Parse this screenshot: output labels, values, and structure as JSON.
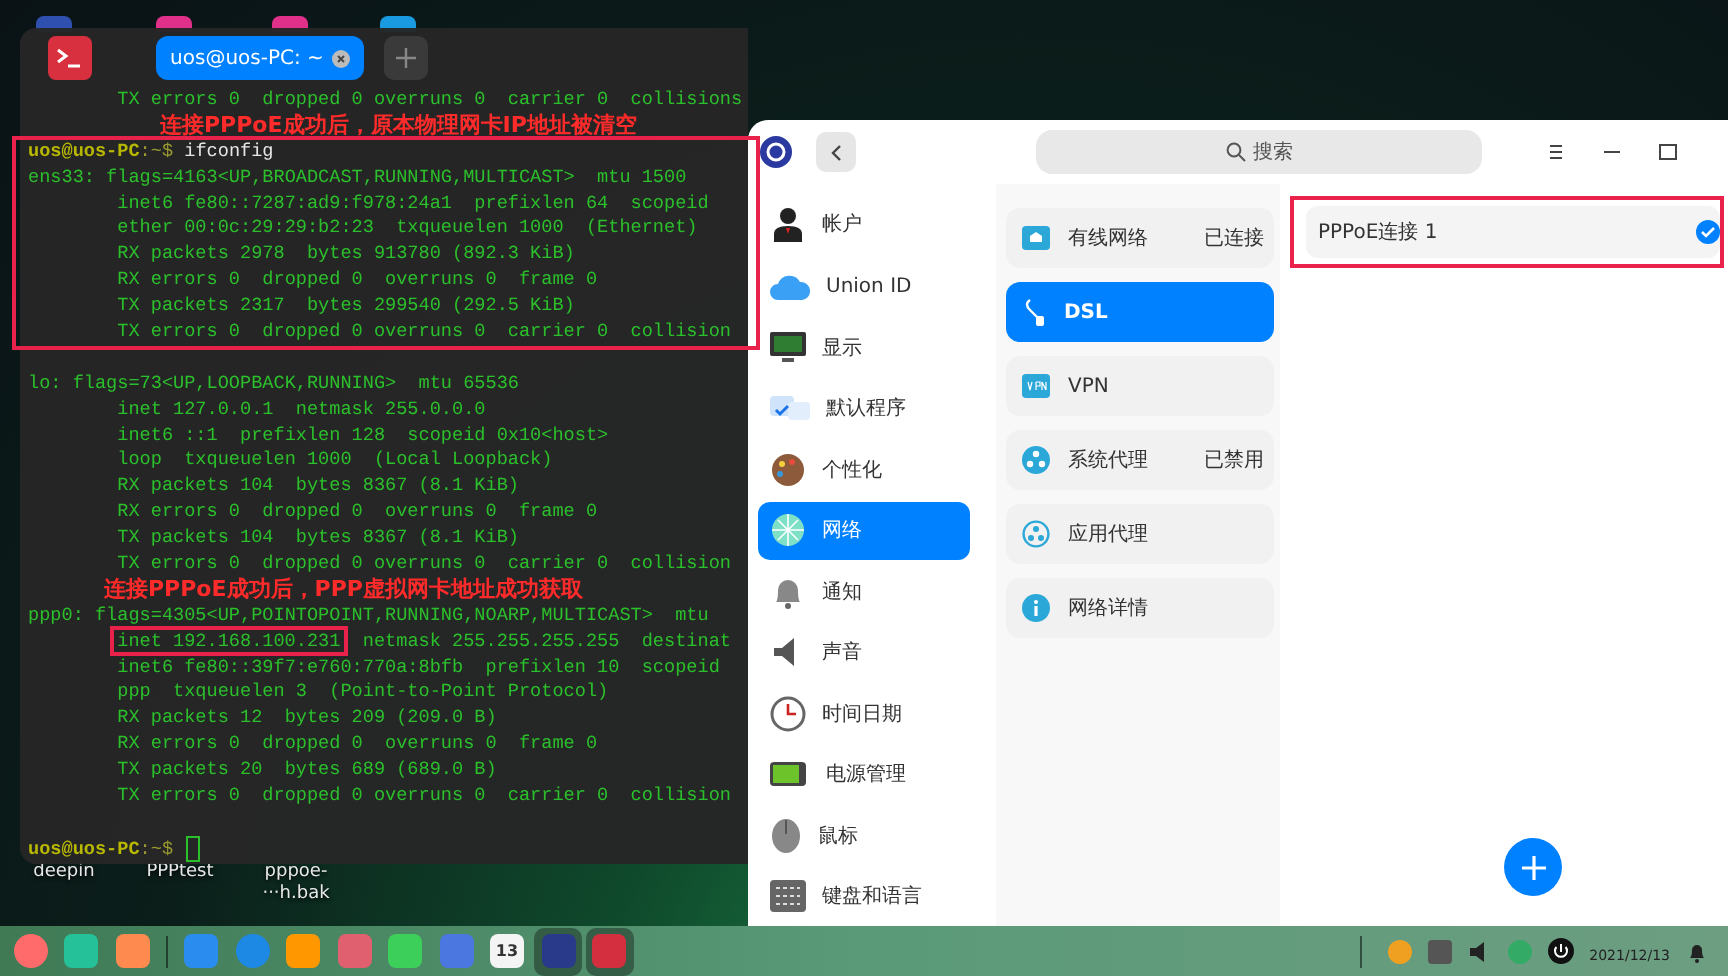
{
  "desktop": {
    "icons": [
      {
        "label_lines": [
          "deepin"
        ]
      },
      {
        "label_lines": [
          "PPPtest"
        ]
      },
      {
        "label_lines": [
          "pppoe-",
          "···h.bak"
        ]
      }
    ]
  },
  "terminal": {
    "tabs": [
      {
        "title": "uos@uos-PC: ~",
        "selected": true
      }
    ],
    "blocks": [
      {
        "highlighted": false,
        "lines": [
          {
            "kind": "output",
            "text": "        TX errors 0  dropped 0 overruns 0  carrier 0  collisions"
          },
          {
            "kind": "caption",
            "text": "连接PPPoE成功后，原本物理网卡IP地址被清空"
          }
        ]
      },
      {
        "highlighted": true,
        "lines": [
          {
            "kind": "prompt",
            "prompt": "uos@uos-PC",
            "path": ":~$",
            "command": "ifconfig",
            "cursor": false
          },
          {
            "kind": "output",
            "text": "ens33: flags=4163<UP,BROADCAST,RUNNING,MULTICAST>  mtu 1500"
          },
          {
            "kind": "output",
            "text": "        inet6 fe80::7287:ad9:f978:24a1  prefixlen 64  scopeid"
          },
          {
            "kind": "output",
            "text": "        ether 00:0c:29:29:b2:23  txqueuelen 1000  (Ethernet)"
          },
          {
            "kind": "output",
            "text": "        RX packets 2978  bytes 913780 (892.3 KiB)"
          },
          {
            "kind": "output",
            "text": "        RX errors 0  dropped 0  overruns 0  frame 0"
          },
          {
            "kind": "output",
            "text": "        TX packets 2317  bytes 299540 (292.5 KiB)"
          },
          {
            "kind": "output",
            "text": "        TX errors 0  dropped 0 overruns 0  carrier 0  collision"
          }
        ]
      },
      {
        "highlighted": false,
        "lines": [
          {
            "kind": "blank"
          },
          {
            "kind": "output",
            "text": "lo: flags=73<UP,LOOPBACK,RUNNING>  mtu 65536"
          },
          {
            "kind": "output",
            "text": "        inet 127.0.0.1  netmask 255.0.0.0"
          },
          {
            "kind": "output",
            "text": "        inet6 ::1  prefixlen 128  scopeid 0x10<host>"
          },
          {
            "kind": "output",
            "text": "        loop  txqueuelen 1000  (Local Loopback)"
          },
          {
            "kind": "output",
            "text": "        RX packets 104  bytes 8367 (8.1 KiB)"
          },
          {
            "kind": "output",
            "text": "        RX errors 0  dropped 0  overruns 0  frame 0"
          },
          {
            "kind": "output",
            "text": "        TX packets 104  bytes 8367 (8.1 KiB)"
          },
          {
            "kind": "output",
            "text": "        TX errors 0  dropped 0 overruns 0  carrier 0  collision"
          },
          {
            "kind": "caption",
            "text": "连接PPPoE成功后，PPP虚拟网卡地址成功获取"
          },
          {
            "kind": "output",
            "text": "ppp0: flags=4305<UP,POINTOPOINT,RUNNING,NOARP,MULTICAST>  mtu"
          },
          {
            "kind": "parts",
            "parts": [
              {
                "text": "inet 192.168.100.231",
                "highlighted": true
              },
              {
                "text": "  netmask 255.255.255.255  destinat",
                "highlighted": false
              }
            ]
          },
          {
            "kind": "output",
            "text": "        inet6 fe80::39f7:e760:770a:8bfb  prefixlen 10  scopeid"
          },
          {
            "kind": "output",
            "text": "        ppp  txqueuelen 3  (Point-to-Point Protocol)"
          },
          {
            "kind": "output",
            "text": "        RX packets 12  bytes 209 (209.0 B)"
          },
          {
            "kind": "output",
            "text": "        RX errors 0  dropped 0  overruns 0  frame 0"
          },
          {
            "kind": "output",
            "text": "        TX packets 20  bytes 689 (689.0 B)"
          },
          {
            "kind": "output",
            "text": "        TX errors 0  dropped 0 overruns 0  carrier 0  collision"
          },
          {
            "kind": "blank"
          },
          {
            "kind": "prompt",
            "prompt": "uos@uos-PC",
            "path": ":~$",
            "cursor": true
          }
        ]
      }
    ]
  },
  "control_center": {
    "search": {
      "placeholder": "搜索"
    },
    "sidebar": {
      "items": [
        {
          "label": "帐户",
          "selected": false
        },
        {
          "label": "Union ID",
          "selected": false
        },
        {
          "label": "显示",
          "selected": false
        },
        {
          "label": "默认程序",
          "selected": false
        },
        {
          "label": "个性化",
          "selected": false
        },
        {
          "label": "网络",
          "selected": true
        },
        {
          "label": "通知",
          "selected": false
        },
        {
          "label": "声音",
          "selected": false
        },
        {
          "label": "时间日期",
          "selected": false
        },
        {
          "label": "电源管理",
          "selected": false
        },
        {
          "label": "鼠标",
          "selected": false
        },
        {
          "label": "键盘和语言",
          "selected": false
        }
      ]
    },
    "network_items": [
      {
        "label": "有线网络",
        "status": "已连接",
        "selected": false
      },
      {
        "label": "DSL",
        "selected": true
      },
      {
        "label": "VPN",
        "selected": false
      },
      {
        "label": "系统代理",
        "status": "已禁用",
        "selected": false
      },
      {
        "label": "应用代理",
        "selected": false
      },
      {
        "label": "网络详情",
        "selected": false
      }
    ],
    "connections": [
      {
        "name": "PPPoE连接 1",
        "connected": true,
        "highlighted": true
      }
    ]
  },
  "taskbar": {
    "apps": [
      {
        "active": false
      },
      {
        "active": false
      },
      {
        "active": false
      },
      {
        "active": false
      },
      {
        "active": false
      },
      {
        "active": false
      },
      {
        "active": false
      },
      {
        "active": false
      },
      {
        "active": false
      },
      {
        "active": false,
        "label": "13"
      },
      {
        "active": true
      },
      {
        "active": true
      }
    ],
    "date": "2021/12/13"
  }
}
